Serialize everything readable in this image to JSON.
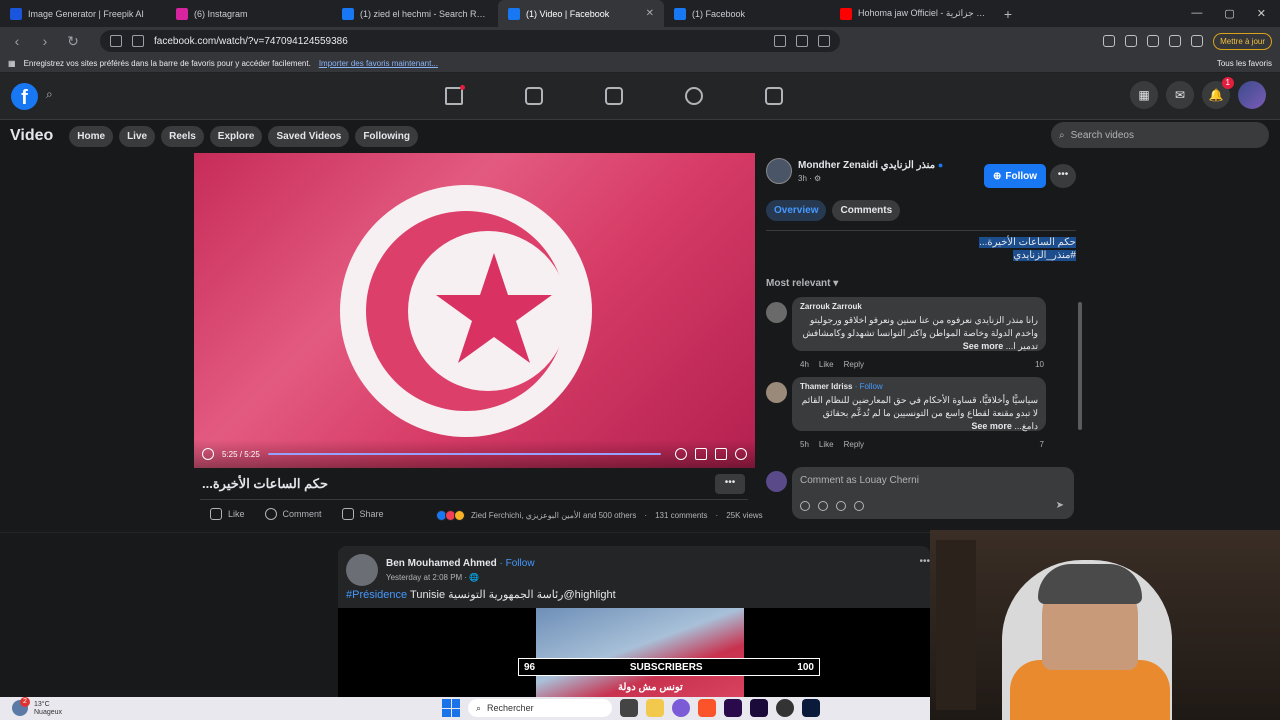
{
  "browser": {
    "tabs": [
      {
        "title": "Image Generator | Freepik AI",
        "fav_color": "#1a56db",
        "active": false
      },
      {
        "title": "(6) Instagram",
        "fav_color": "#d6249f",
        "active": false
      },
      {
        "title": "(1) zied el hechmi - Search Results | F",
        "fav_color": "#1877f2",
        "active": false
      },
      {
        "title": "(1) Video | Facebook",
        "fav_color": "#1877f2",
        "active": true
      },
      {
        "title": "(1) Facebook",
        "fav_color": "#1877f2",
        "active": false
      },
      {
        "title": "Hohoma jaw Officiel - أغنية جزائرية - Y",
        "fav_color": "#ff0000",
        "active": false
      }
    ],
    "url": "facebook.com/watch/?v=747094124559386",
    "update_label": "Mettre à jour",
    "bookmarks_msg": "Enregistrez vos sites préférés dans la barre de favoris pour y accéder facilement.",
    "bookmarks_link": "Importer des favoris maintenant...",
    "all_bookmarks": "Tous les favoris"
  },
  "fb": {
    "notif_count": "1",
    "section_title": "Video",
    "nav_pills": [
      "Home",
      "Live",
      "Reels",
      "Explore",
      "Saved Videos",
      "Following"
    ],
    "search_placeholder": "Search videos"
  },
  "player": {
    "time": "5:25 / 5:25",
    "title": "حكم الساعات الأخيرة...",
    "like": "Like",
    "comment": "Comment",
    "share": "Share",
    "reactors": "Zied Ferchichi, الأمين البوعزيزي and 500 others",
    "comments_count": "131 comments",
    "views": "25K views"
  },
  "sidebar": {
    "poster_name": "Mondher Zenaidi منذر الزنايدي",
    "poster_time": "3h · ⚙",
    "follow_label": "Follow",
    "tabs": [
      "Overview",
      "Comments"
    ],
    "caption_line1": "حكم الساعات الأخيرة...",
    "caption_line2": "#منذر_الزنايدي",
    "sort_label": "Most relevant ▾",
    "comments": [
      {
        "name": "Zarrouk Zarrouk",
        "follow": "",
        "text": "رانا منذر الزنايدي نعرفوه من عنا سنين ونعرفو اخلاقو ورجوليتو واخدم الدولة وخاصة المواطن واكثر التوانسا تشهدلو وكامشافش تدمير ا...",
        "see_more": "See more",
        "time": "4h",
        "like": "Like",
        "reply": "Reply",
        "count": "10"
      },
      {
        "name": "Thamer Idriss",
        "follow": "· Follow",
        "text": "سياسيًّا وأخلاقيًّا، قساوة الأحكام في حق المعارضين للنظام القائم لا تبدو مقنعة لقطاع واسع من التونسيين ما لم تُدعَّم بحقائق دامغ...",
        "see_more": "See more",
        "time": "5h",
        "like": "Like",
        "reply": "Reply",
        "count": "7"
      }
    ],
    "compose_placeholder": "Comment as Louay Cherni"
  },
  "feed_post": {
    "author": "Ben Mouhamed Ahmed",
    "follow": "· Follow",
    "time": "Yesterday at 2:08 PM · 🌐",
    "hashtag": "#Présidence",
    "text": " Tunisie رئاسة الجمهورية التونسية@highlight",
    "image_text": "تونس مش دولة"
  },
  "overlay": {
    "left_num": "96",
    "label": "SUBSCRIBERS",
    "right_num": "100"
  },
  "taskbar": {
    "weather_temp": "13°C",
    "weather_desc": "Nuageux",
    "weather_badge": "2",
    "search_label": "Rechercher"
  }
}
